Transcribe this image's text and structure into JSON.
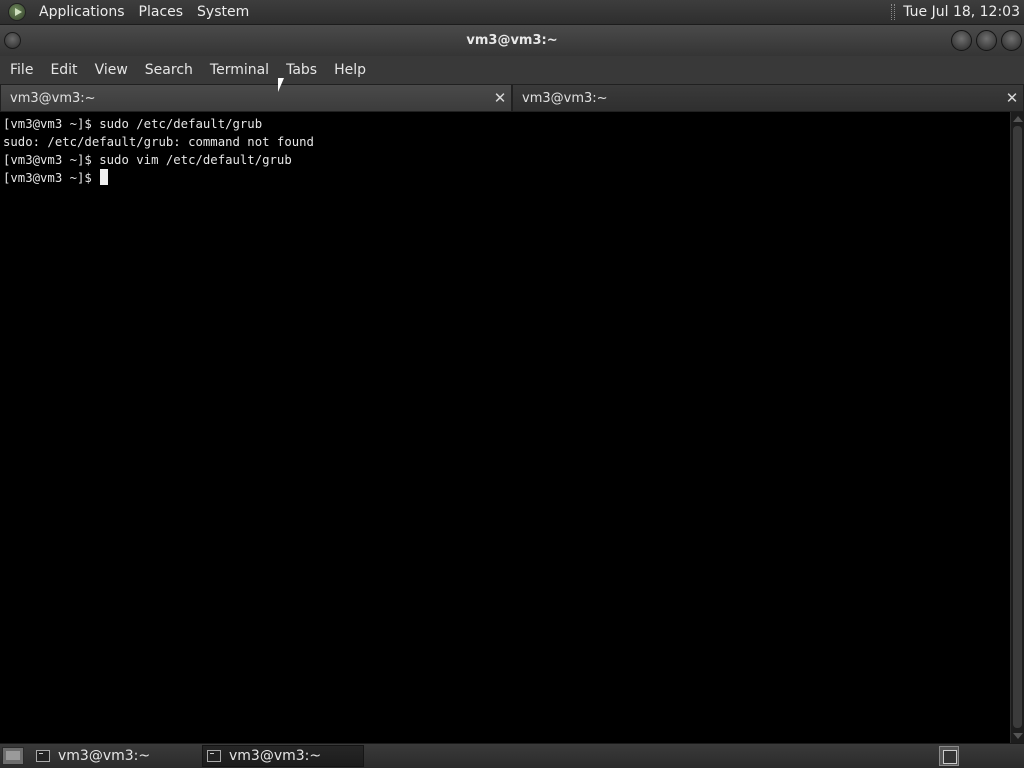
{
  "top_panel": {
    "menus": [
      "Applications",
      "Places",
      "System"
    ],
    "clock": "Tue Jul 18, 12:03"
  },
  "window": {
    "title": "vm3@vm3:~"
  },
  "menubar": {
    "items": [
      "File",
      "Edit",
      "View",
      "Search",
      "Terminal",
      "Tabs",
      "Help"
    ]
  },
  "tabs": [
    {
      "label": "vm3@vm3:~",
      "active": true
    },
    {
      "label": "vm3@vm3:~",
      "active": false
    }
  ],
  "terminal": {
    "lines": [
      "[vm3@vm3 ~]$ sudo /etc/default/grub",
      "sudo: /etc/default/grub: command not found",
      "[vm3@vm3 ~]$ sudo vim /etc/default/grub",
      "[vm3@vm3 ~]$ "
    ]
  },
  "taskbar": {
    "tasks": [
      {
        "label": "vm3@vm3:~",
        "current": false
      },
      {
        "label": "vm3@vm3:~",
        "current": true
      }
    ]
  }
}
